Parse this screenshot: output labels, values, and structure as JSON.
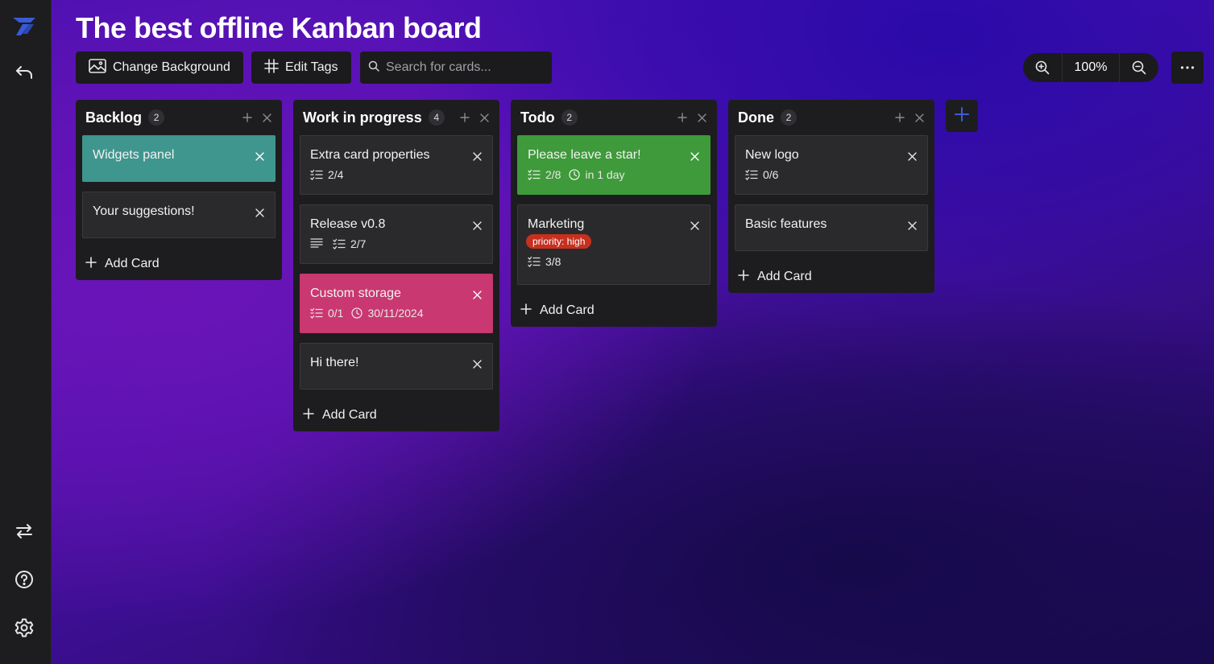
{
  "app": {
    "title": "The best offline Kanban board"
  },
  "toolbar": {
    "change_background_label": "Change Background",
    "edit_tags_label": "Edit Tags",
    "search_placeholder": "Search for cards...",
    "zoom_level": "100%"
  },
  "sidebar": {
    "icons": [
      "logo-icon",
      "back-arrow-icon",
      "swap-icon",
      "help-icon",
      "settings-icon"
    ]
  },
  "columns": [
    {
      "title": "Backlog",
      "count": "2",
      "cards": [
        {
          "title": "Widgets panel",
          "color": "#3f968e"
        },
        {
          "title": "Your suggestions!"
        }
      ],
      "add_card_label": "Add Card"
    },
    {
      "title": "Work in progress",
      "count": "4",
      "cards": [
        {
          "title": "Extra card properties",
          "checklist": "2/4"
        },
        {
          "title": "Release v0.8",
          "checklist": "2/7",
          "has_description": true
        },
        {
          "title": "Custom storage",
          "checklist": "0/1",
          "due": "30/11/2024",
          "color": "#c93870"
        },
        {
          "title": "Hi there!"
        }
      ],
      "add_card_label": "Add Card"
    },
    {
      "title": "Todo",
      "count": "2",
      "cards": [
        {
          "title": "Please leave a star!",
          "checklist": "2/8",
          "due": "in 1 day",
          "color": "#3e9a3a"
        },
        {
          "title": "Marketing",
          "tag": "priority: high",
          "checklist": "3/8"
        }
      ],
      "add_card_label": "Add Card"
    },
    {
      "title": "Done",
      "count": "2",
      "cards": [
        {
          "title": "New logo",
          "checklist": "0/6"
        },
        {
          "title": "Basic features"
        }
      ],
      "add_card_label": "Add Card"
    }
  ],
  "colors": {
    "accent": "#3b5bdb",
    "column_bg": "#1d1d1f",
    "card_bg": "#2a2a2d",
    "tag_high": "#c7301f"
  }
}
